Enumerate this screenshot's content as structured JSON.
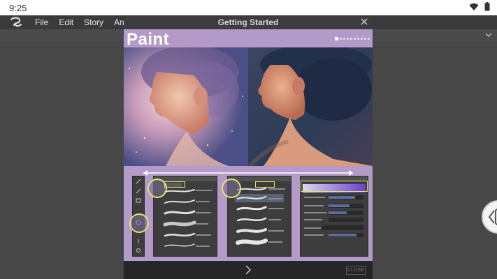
{
  "status_bar": {
    "time": "9:25"
  },
  "menu": {
    "items": [
      "File",
      "Edit",
      "Story",
      "Anir"
    ]
  },
  "dialog": {
    "title": "Getting Started",
    "heading": "Paint",
    "close_button_label": "CLOSE",
    "page_count": 10,
    "active_page": 1
  },
  "colors": {
    "content_background": "#b39ac9",
    "highlight": "#e6e36a"
  },
  "icons": {
    "app_logo": "app-logo-icon",
    "wifi": "wifi-icon",
    "battery": "battery-icon",
    "close": "close-icon",
    "next": "chevron-right-icon",
    "collapse": "chevron-down-icon",
    "side_panel": "chevron-left-icon"
  }
}
